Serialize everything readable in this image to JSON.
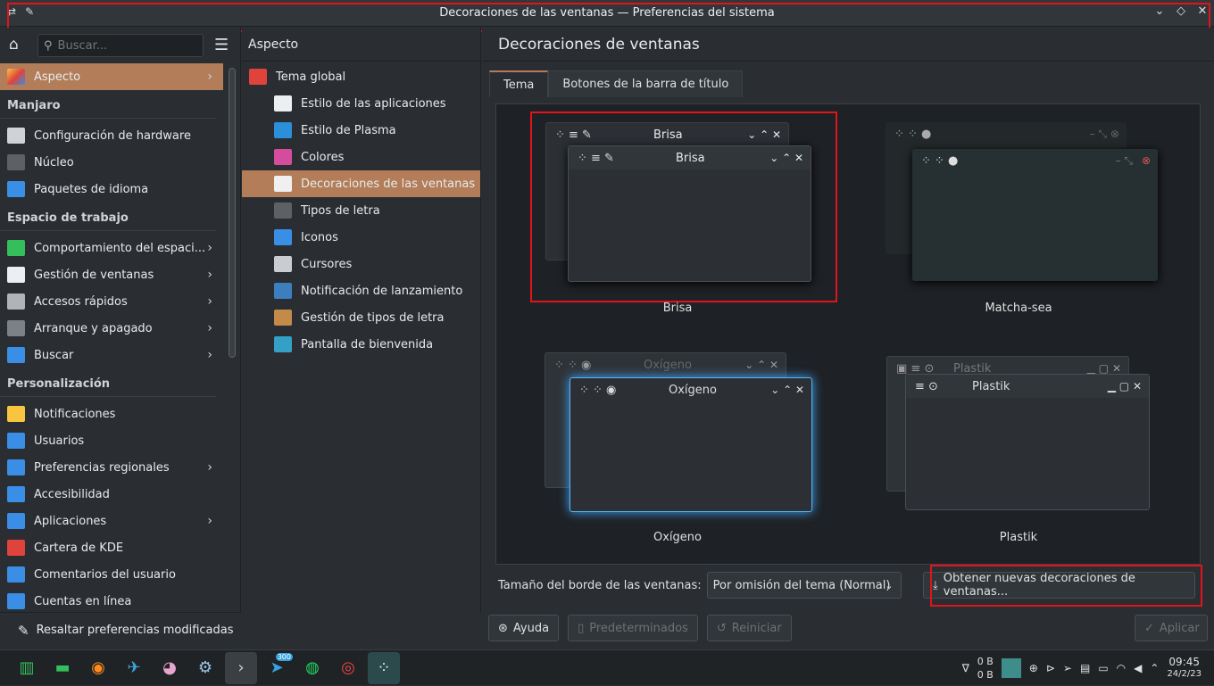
{
  "window": {
    "title": "Decoraciones de las ventanas — Preferencias del sistema"
  },
  "search": {
    "placeholder": "Buscar..."
  },
  "sidebar": {
    "selected": "Aspecto",
    "sections": [
      {
        "title": "Manjaro",
        "items": [
          {
            "label": "Configuración de hardware",
            "icon": "hardware-icon"
          },
          {
            "label": "Núcleo",
            "icon": "kernel-icon"
          },
          {
            "label": "Paquetes de idioma",
            "icon": "language-icon"
          }
        ]
      },
      {
        "title": "Espacio de trabajo",
        "items": [
          {
            "label": "Comportamiento del espaci...",
            "icon": "workspace-icon",
            "chevron": true
          },
          {
            "label": "Gestión de ventanas",
            "icon": "window-icon",
            "chevron": true
          },
          {
            "label": "Accesos rápidos",
            "icon": "keyboard-icon",
            "chevron": true
          },
          {
            "label": "Arranque y apagado",
            "icon": "startup-icon",
            "chevron": true
          },
          {
            "label": "Buscar",
            "icon": "search-icon",
            "chevron": true
          }
        ]
      },
      {
        "title": "Personalización",
        "items": [
          {
            "label": "Notificaciones",
            "icon": "bell-icon"
          },
          {
            "label": "Usuarios",
            "icon": "users-icon"
          },
          {
            "label": "Preferencias regionales",
            "icon": "regional-icon",
            "chevron": true
          },
          {
            "label": "Accesibilidad",
            "icon": "accessibility-icon"
          },
          {
            "label": "Aplicaciones",
            "icon": "apps-icon",
            "chevron": true
          },
          {
            "label": "Cartera de KDE",
            "icon": "wallet-icon"
          },
          {
            "label": "Comentarios del usuario",
            "icon": "feedback-icon"
          },
          {
            "label": "Cuentas en línea",
            "icon": "online-accounts-icon"
          }
        ]
      }
    ],
    "highlight_label": "Resaltar preferencias modificadas"
  },
  "subnav": {
    "title": "Aspecto",
    "items": [
      {
        "label": "Tema global",
        "top": true,
        "color": "#e0433b"
      },
      {
        "label": "Estilo de las aplicaciones",
        "color": "#eceff1"
      },
      {
        "label": "Estilo de Plasma",
        "color": "#2b8fd9"
      },
      {
        "label": "Colores",
        "color": "#d44d9c"
      },
      {
        "label": "Decoraciones de las ventanas",
        "color": "#f0f0f0",
        "selected": true
      },
      {
        "label": "Tipos de letra",
        "color": "#5d6166"
      },
      {
        "label": "Iconos",
        "color": "#3a8ee6"
      },
      {
        "label": "Cursores",
        "color": "#c9cdd1"
      },
      {
        "label": "Notificación de lanzamiento",
        "color": "#3d7ebf"
      },
      {
        "label": "Gestión de tipos de letra",
        "color": "#c48a4a"
      },
      {
        "label": "Pantalla de bienvenida",
        "color": "#34a0c5"
      }
    ]
  },
  "main": {
    "title": "Decoraciones de ventanas",
    "tabs": [
      "Tema",
      "Botones de la barra de título"
    ],
    "decorations": [
      {
        "name": "Brisa",
        "win_title": "Brisa"
      },
      {
        "name": "Matcha-sea",
        "win_title": ""
      },
      {
        "name": "Oxígeno",
        "win_title": "Oxígeno",
        "bg_title": "Oxígeno"
      },
      {
        "name": "Plastik",
        "win_title": "Plastik",
        "bg_title": "Plastik"
      }
    ],
    "border_label": "Tamaño del borde de las ventanas:",
    "border_value": "Por omisión del tema (Normal)",
    "get_new_label": "Obtener nuevas decoraciones de ventanas...",
    "help_label": "Ayuda",
    "defaults_label": "Predeterminados",
    "reset_label": "Reiniciar",
    "apply_label": "Aplicar"
  },
  "tray": {
    "net_down": "0 B",
    "net_up": "0 B",
    "time": "09:45",
    "date": "24/2/23",
    "badge": "300"
  }
}
